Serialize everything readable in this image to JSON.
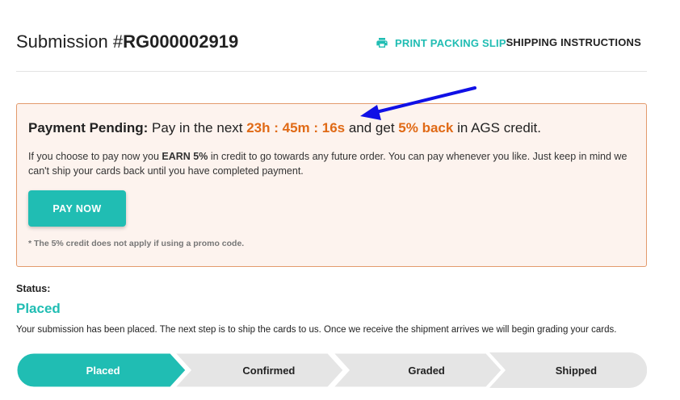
{
  "header": {
    "title_prefix": "Submission #",
    "submission_number": "RG000002919",
    "print_label": "PRINT PACKING SLIP",
    "print_icon": "printer-icon",
    "shipping_label": "SHIPPING INSTRUCTIONS"
  },
  "payment": {
    "label": "Payment Pending:",
    "text_before": " Pay in the next ",
    "countdown": "23h : 45m : 16s",
    "text_middle": " and get ",
    "credit": "5% back",
    "text_after": " in AGS credit.",
    "body_before": "If you choose to pay now you ",
    "body_bold": "EARN 5%",
    "body_after": " in credit to go towards any future order. You can pay whenever you like. Just keep in mind we can't ship your cards back until you have completed payment.",
    "pay_button": "PAY NOW",
    "footnote": "* The 5% credit does not apply if using a promo code."
  },
  "status": {
    "label": "Status:",
    "value": "Placed",
    "description": "Your submission has been placed. The next step is to ship the cards to us. Once we receive the shipment arrives we will begin grading your cards."
  },
  "steps": [
    {
      "label": "Placed",
      "active": true
    },
    {
      "label": "Confirmed",
      "active": false
    },
    {
      "label": "Graded",
      "active": false
    },
    {
      "label": "Shipped",
      "active": false
    }
  ],
  "colors": {
    "accent": "#20bdb3",
    "highlight": "#e06a16",
    "notice_bg": "#fdf3ee",
    "notice_border": "#e39a6c",
    "step_inactive": "#e5e5e5",
    "annotation_arrow": "#1010e6"
  }
}
